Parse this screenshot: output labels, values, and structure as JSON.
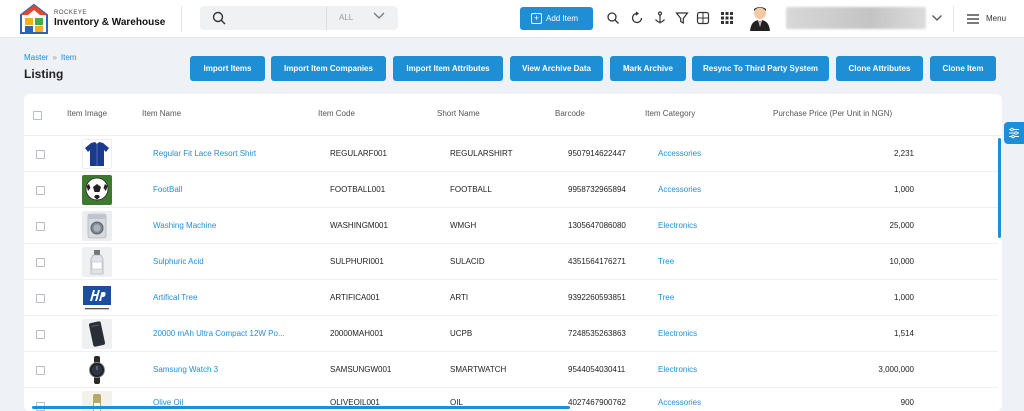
{
  "brand": {
    "top": "ROCKEYE",
    "name": "Inventory & Warehouse"
  },
  "search": {
    "placeholder": "",
    "scope": "ALL"
  },
  "header": {
    "add_item_label": "Add Item",
    "menu_label": "Menu",
    "tools": [
      "search-icon",
      "refresh-icon",
      "anchor-icon",
      "filter-icon",
      "calculator-icon",
      "apps-grid-icon"
    ]
  },
  "breadcrumb": {
    "items": [
      "Master",
      "Item"
    ]
  },
  "page": {
    "title": "Listing"
  },
  "actions": [
    "Import Items",
    "Import Item Companies",
    "Import Item Attributes",
    "View Archive Data",
    "Mark Archive",
    "Resync To Third Party System",
    "Clone Attributes",
    "Clone Item"
  ],
  "table": {
    "columns": [
      "Item Image",
      "Item Name",
      "Item Code",
      "Short Name",
      "Barcode",
      "Item Category",
      "Purchase Price (Per Unit in NGN)"
    ],
    "rows": [
      {
        "name": "Regular Fit Lace Resort Shirt",
        "code": "REGULARF001",
        "short": "REGULARSHIRT",
        "barcode": "9507914622447",
        "category": "Accessories",
        "price": "2,231",
        "image": "shirt"
      },
      {
        "name": "FootBall",
        "code": "FOOTBALL001",
        "short": "FOOTBALL",
        "barcode": "9958732965894",
        "category": "Accessories",
        "price": "1,000",
        "image": "football"
      },
      {
        "name": "Washing Machine",
        "code": "WASHINGM001",
        "short": "WMGH",
        "barcode": "1305647086080",
        "category": "Electronics",
        "price": "25,000",
        "image": "washer"
      },
      {
        "name": "Sulphuric Acid",
        "code": "SULPHURI001",
        "short": "SULACID",
        "barcode": "4351564176271",
        "category": "Tree",
        "price": "10,000",
        "image": "bottle"
      },
      {
        "name": "Artifical Tree",
        "code": "ARTIFICA001",
        "short": "ARTI",
        "barcode": "9392260593851",
        "category": "Tree",
        "price": "1,000",
        "image": "hp-logo"
      },
      {
        "name": "20000 mAh Ultra Compact 12W Po...",
        "code": "20000MAH001",
        "short": "UCPB",
        "barcode": "7248535263863",
        "category": "Electronics",
        "price": "1,514",
        "image": "powerbank"
      },
      {
        "name": "Samsung Watch 3",
        "code": "SAMSUNGW001",
        "short": "SMARTWATCH",
        "barcode": "9544054030411",
        "category": "Electronics",
        "price": "3,000,000",
        "image": "watch"
      },
      {
        "name": "Olive Oil",
        "code": "OLIVEOIL001",
        "short": "OIL",
        "barcode": "4027467900762",
        "category": "Accessories",
        "price": "900",
        "image": "oil"
      }
    ]
  },
  "colors": {
    "accent": "#1f8fd5",
    "background": "#eef2f7"
  }
}
